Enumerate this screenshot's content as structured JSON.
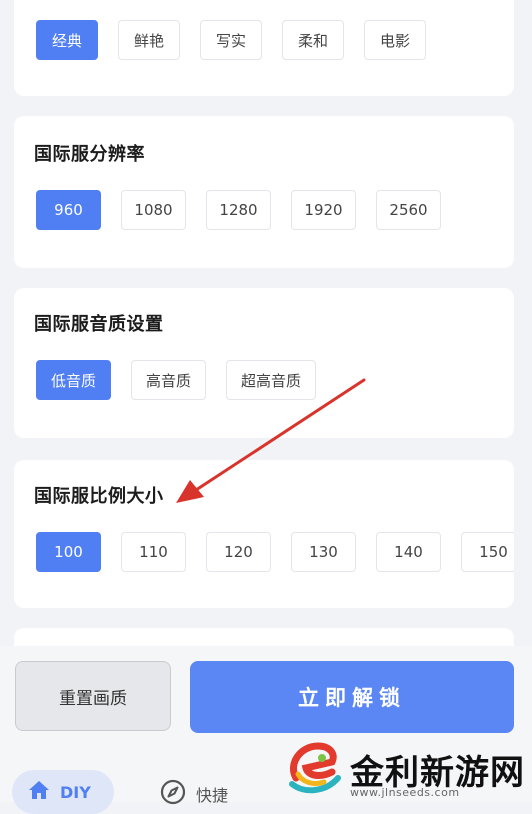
{
  "style_section": {
    "options": [
      "经典",
      "鲜艳",
      "写实",
      "柔和",
      "电影"
    ],
    "selected_index": 0
  },
  "resolution_section": {
    "title": "国际服分辨率",
    "options": [
      "960",
      "1080",
      "1280",
      "1920",
      "2560"
    ],
    "selected_index": 0
  },
  "audio_section": {
    "title": "国际服音质设置",
    "options": [
      "低音质",
      "高音质",
      "超高音质"
    ],
    "selected_index": 0
  },
  "ratio_section": {
    "title": "国际服比例大小",
    "options": [
      "100",
      "110",
      "120",
      "130",
      "140",
      "150"
    ],
    "selected_index": 0
  },
  "actions": {
    "reset_label": "重置画质",
    "unlock_label": "立即解锁"
  },
  "bottom_nav": {
    "diy_label": "DIY",
    "quick_label": "快捷"
  },
  "watermark": {
    "text": "金利新游网",
    "url": "www.jlnseeds.com"
  },
  "colors": {
    "accent": "#4f7ff2",
    "unlock_button": "#5b87f5",
    "arrow": "#d9342b"
  }
}
